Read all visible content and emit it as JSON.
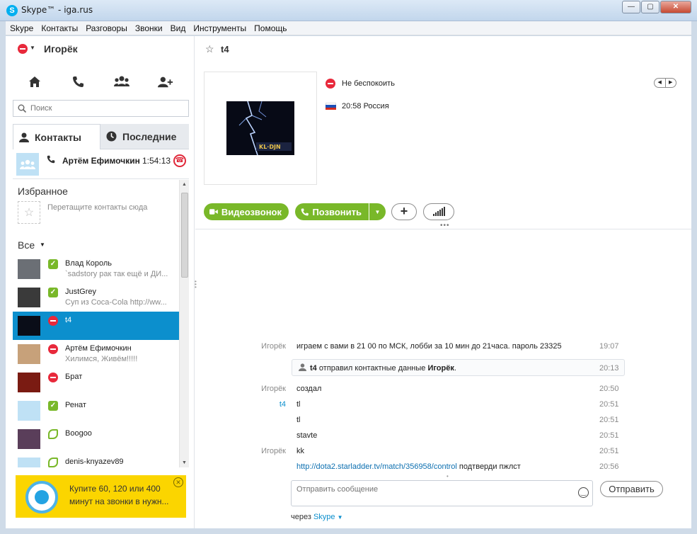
{
  "window": {
    "title": "Skype™ - iga.rus",
    "icon": "skype-icon",
    "controls": [
      "minimize",
      "maximize",
      "close"
    ]
  },
  "menu": [
    "Skype",
    "Контакты",
    "Разговоры",
    "Звонки",
    "Вид",
    "Инструменты",
    "Помощь"
  ],
  "me": {
    "name": "Игорёк",
    "status_icon": "do-not-disturb-icon"
  },
  "nav_icons": [
    "home-icon",
    "phone-icon",
    "group-icon",
    "add-contact-icon"
  ],
  "search": {
    "placeholder": "Поиск"
  },
  "tabs": {
    "contacts": "Контакты",
    "recent": "Последние"
  },
  "active_call": {
    "name": "Артём Ефимочкин",
    "duration": "1:54:13"
  },
  "favorites": {
    "title": "Избранное",
    "hint": "Перетащите контакты сюда"
  },
  "all": {
    "title": "Все"
  },
  "contacts": [
    {
      "name": "Влад Король",
      "mood": "`sadstory рак так ещё и ДИ...",
      "status": "online",
      "avatar_color": "#6b6f75"
    },
    {
      "name": "JustGrey",
      "mood": "Суп из Coca-Cola http://ww...",
      "status": "online",
      "avatar_color": "#3a3a3a"
    },
    {
      "name": "t4",
      "mood": "",
      "status": "dnd",
      "avatar_color": "#0a0d18",
      "selected": true
    },
    {
      "name": "Артём Ефимочкин",
      "mood": "Хилимся, Живём!!!!!",
      "status": "dnd",
      "avatar_color": "#c7a17a"
    },
    {
      "name": "Брат",
      "mood": "",
      "status": "dnd",
      "avatar_color": "#7a1b12"
    },
    {
      "name": "Ренат",
      "mood": "",
      "status": "online",
      "avatar_color": "#bfe1f5"
    },
    {
      "name": "Boogoo",
      "mood": "",
      "status": "offline",
      "avatar_color": "#5a3e5a"
    },
    {
      "name": "denis-knyazev89",
      "mood": "",
      "status": "offline",
      "avatar_color": "#bfe1f5"
    }
  ],
  "ad": {
    "text": "Купите 60, 120 или 400 минут на звонки в нужн..."
  },
  "conversation": {
    "title": "t4",
    "status_text": "Не беспокоить",
    "location_text": "20:58 Россия",
    "video_button": "Видеозвонок",
    "call_button": "Позвонить"
  },
  "messages": [
    {
      "sender": "Игорёк",
      "text": "играем с вами в 21 00 по МСК, лобби за 10 мин до 21часа. пароль 23325",
      "time": "19:07"
    },
    {
      "sender": "Игорёк",
      "text": "создал",
      "time": "20:50"
    },
    {
      "sender": "t4",
      "text": "tl",
      "time": "20:51"
    },
    {
      "sender": "",
      "text": "tl",
      "time": "20:51"
    },
    {
      "sender": "",
      "text": "stavte",
      "time": "20:51"
    },
    {
      "sender": "Игорёк",
      "text": "kk",
      "time": "20:51"
    },
    {
      "sender": "",
      "link": "http://dota2.starladder.tv/match/356958/control",
      "text": " подтверди пжлст",
      "time": "20:56"
    }
  ],
  "system_message": {
    "sender": "t4",
    "action": " отправил контактные данные ",
    "target": "Игорёк",
    "suffix": ".",
    "time": "20:13"
  },
  "compose": {
    "placeholder": "Отправить сообщение",
    "send_label": "Отправить",
    "via_prefix": "через ",
    "via_link": "Skype"
  },
  "colors": {
    "accent": "#0c8fcd",
    "green": "#79b829",
    "dnd_red": "#e8293b",
    "ad_yellow": "#fbd500"
  }
}
